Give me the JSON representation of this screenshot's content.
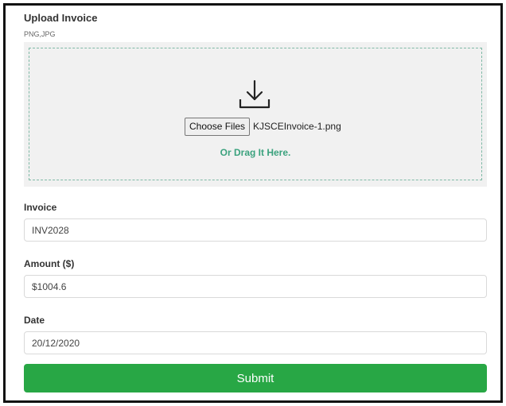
{
  "upload": {
    "title": "Upload Invoice",
    "formats": "PNG,JPG",
    "choose_button": "Choose Files",
    "selected_file": "KJSCEInvoice-1.png",
    "drag_text": "Or Drag It Here."
  },
  "form": {
    "invoice": {
      "label": "Invoice",
      "value": "INV2028"
    },
    "amount": {
      "label": "Amount ($)",
      "value": "$1004.6"
    },
    "date": {
      "label": "Date",
      "value": "20/12/2020"
    },
    "submit_label": "Submit"
  },
  "colors": {
    "accent_green": "#28a745",
    "drag_text_green": "#3ba27e",
    "dropzone_bg": "#f1f1f1"
  },
  "icons": {
    "upload": "download-tray-icon"
  }
}
